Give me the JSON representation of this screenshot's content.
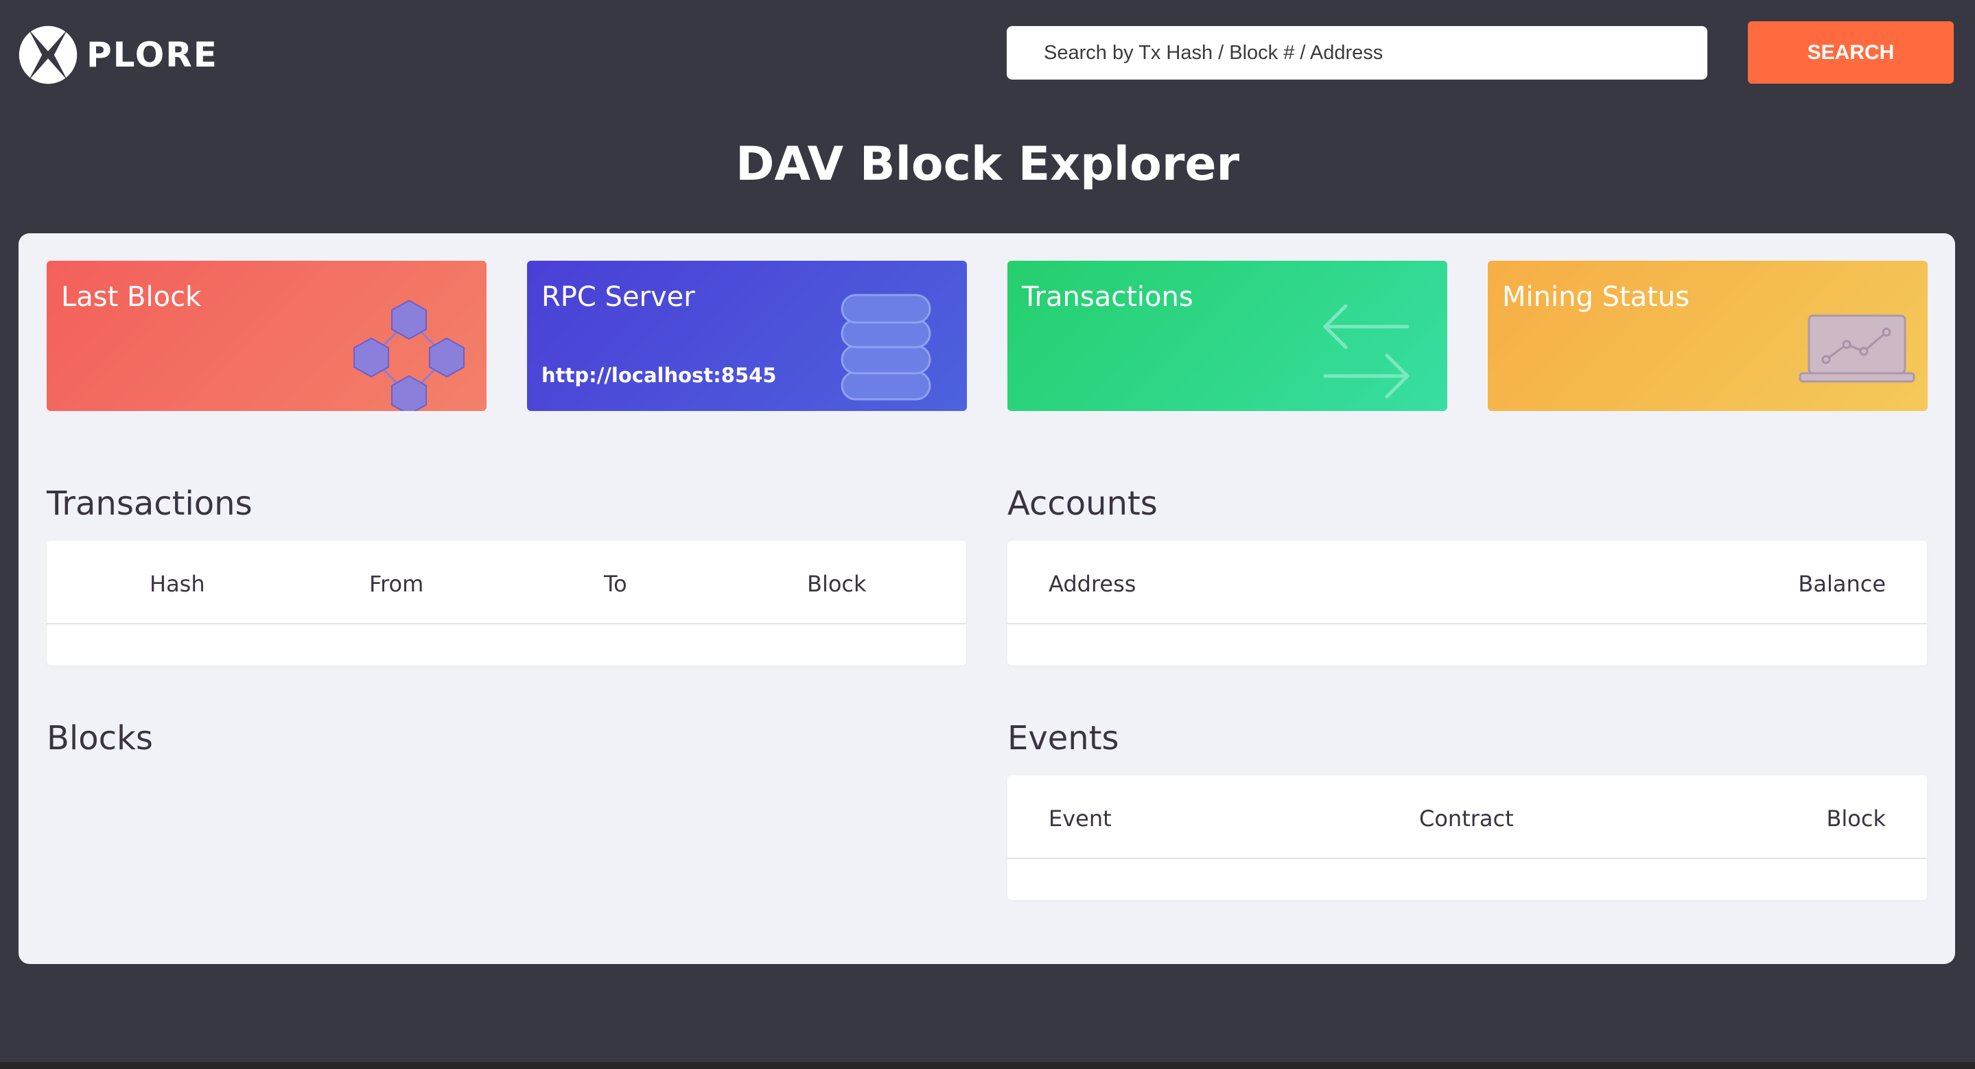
{
  "brand": {
    "logo_text": "PLORE"
  },
  "search": {
    "placeholder": "Search by Tx Hash / Block # / Address",
    "button_label": "SEARCH"
  },
  "page_title": "DAV Block Explorer",
  "cards": [
    {
      "title": "Last Block",
      "sub": "",
      "icon": "blocks-icon",
      "color": "#f3605a"
    },
    {
      "title": "RPC Server",
      "sub": "http://localhost:8545",
      "icon": "database-icon",
      "color": "#4a3fd6"
    },
    {
      "title": "Transactions",
      "sub": "",
      "icon": "exchange-arrows-icon",
      "color": "#25cf6d"
    },
    {
      "title": "Mining Status",
      "sub": "",
      "icon": "laptop-chart-icon",
      "color": "#f6ae45"
    }
  ],
  "sections": {
    "transactions": {
      "title": "Transactions",
      "columns": [
        "Hash",
        "From",
        "To",
        "Block"
      ]
    },
    "accounts": {
      "title": "Accounts",
      "columns": [
        "Address",
        "Balance"
      ]
    },
    "blocks": {
      "title": "Blocks"
    },
    "events": {
      "title": "Events",
      "columns": [
        "Event",
        "Contract",
        "Block"
      ]
    }
  },
  "colors": {
    "background": "#373842",
    "accent": "#ff6b3e",
    "panel": "#f1f2f7"
  }
}
